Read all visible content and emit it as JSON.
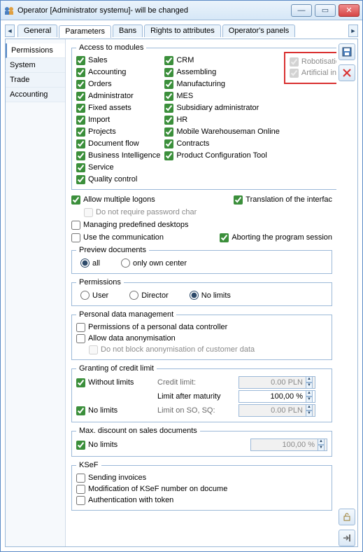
{
  "window": {
    "title": "Operator [Administrator systemu]- will be changed"
  },
  "tabs": {
    "general": "General",
    "parameters": "Parameters",
    "bans": "Bans",
    "rights": "Rights to attributes",
    "panels": "Operator's panels"
  },
  "leftnav": {
    "permissions": "Permissions",
    "system": "System",
    "trade": "Trade",
    "accounting": "Accounting"
  },
  "access": {
    "legend": "Access to modules",
    "col1": {
      "sales": "Sales",
      "accounting": "Accounting",
      "orders": "Orders",
      "administrator": "Administrator",
      "fixed_assets": "Fixed assets",
      "import": "Import",
      "projects": "Projects",
      "document_flow": "Document flow",
      "bi": "Business Intelligence",
      "service": "Service",
      "quality": "Quality control"
    },
    "col2": {
      "crm": "CRM",
      "assembling": "Assembling",
      "manufacturing": "Manufacturing",
      "mes": "MES",
      "subs_admin": "Subsidiary administrator",
      "hr": "HR",
      "mwo": "Mobile Warehouseman Online",
      "contracts": "Contracts",
      "pct": "Product Configuration Tool"
    },
    "col3": {
      "rpa": "Robotisation (RPA)",
      "ai": "Artificial intel. (AI)"
    }
  },
  "misc": {
    "allow_multiple": "Allow multiple logons",
    "translation": "Translation of the interfac",
    "no_pwd_char": "Do not require password char",
    "manage_desktops": "Managing predefined desktops",
    "use_comm": "Use the communication",
    "abort_session": "Aborting the program session"
  },
  "preview": {
    "legend": "Preview documents",
    "all": "all",
    "own": "only own center"
  },
  "permissions": {
    "legend": "Permissions",
    "user": "User",
    "director": "Director",
    "nolimits": "No limits"
  },
  "pdm": {
    "legend": "Personal data management",
    "controller": "Permissions of a personal data controller",
    "allow_anon": "Allow data anonymisation",
    "no_block": "Do not block anonymisation of customer data"
  },
  "credit": {
    "legend": "Granting of credit limit",
    "without_limits": "Without limits",
    "credit_limit_label": "Credit limit:",
    "credit_limit_value": "0.00 PLN",
    "limit_after_label": "Limit after maturity",
    "limit_after_value": "100,00 %",
    "no_limits2": "No limits",
    "so_label": "Limit on SO, SQ:",
    "so_value": "0.00 PLN"
  },
  "maxdisc": {
    "legend": "Max. discount on sales documents",
    "no_limits": "No limits",
    "value": "100,00 %"
  },
  "ksef": {
    "legend": "KSeF",
    "sending": "Sending invoices",
    "modify": "Modification of KSeF number on docume",
    "auth": "Authentication with token"
  }
}
